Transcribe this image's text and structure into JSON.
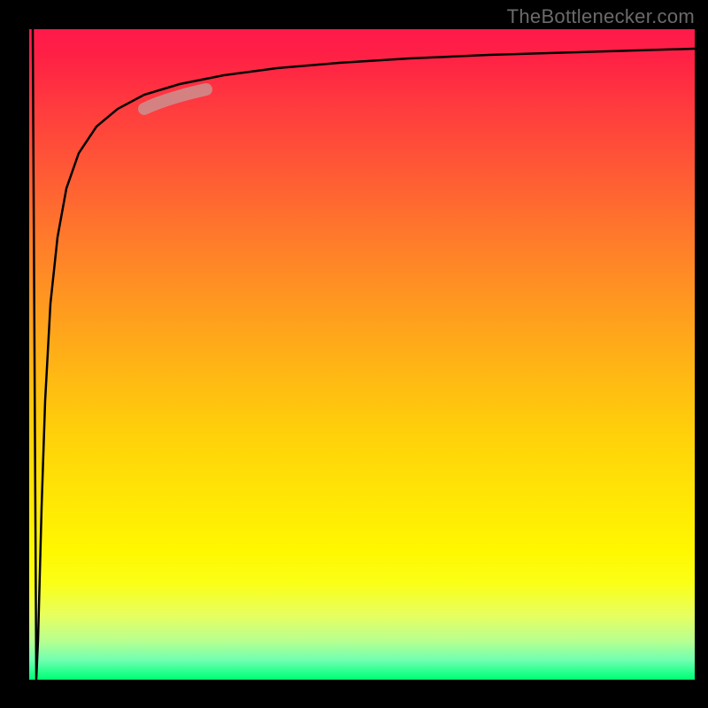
{
  "attribution_text": "TheBottlenecker.com",
  "chart_data": {
    "type": "line",
    "title": "",
    "xlabel": "",
    "ylabel": "",
    "xlim": [
      0,
      100
    ],
    "ylim": [
      0,
      100
    ],
    "series": [
      {
        "name": "curve",
        "type": "line",
        "points": [
          {
            "x": 0.5,
            "y": 100
          },
          {
            "x": 1.0,
            "y": 0
          },
          {
            "x": 1.5,
            "y": 30
          },
          {
            "x": 2.0,
            "y": 48
          },
          {
            "x": 3.0,
            "y": 65
          },
          {
            "x": 5.0,
            "y": 77
          },
          {
            "x": 8.0,
            "y": 84
          },
          {
            "x": 12.0,
            "y": 88
          },
          {
            "x": 18.0,
            "y": 91
          },
          {
            "x": 25.0,
            "y": 93
          },
          {
            "x": 35.0,
            "y": 94.5
          },
          {
            "x": 50.0,
            "y": 95.5
          },
          {
            "x": 70.0,
            "y": 96.3
          },
          {
            "x": 100.0,
            "y": 97
          }
        ]
      },
      {
        "name": "highlight_segment",
        "type": "line_segment",
        "color": "#d67676",
        "points": [
          {
            "x": 16,
            "y": 88
          },
          {
            "x": 27,
            "y": 91
          }
        ]
      }
    ],
    "gradient_background": {
      "direction": "vertical",
      "stops": [
        {
          "pos": 0,
          "color": "#ff1a4a"
        },
        {
          "pos": 50,
          "color": "#ffd00a"
        },
        {
          "pos": 85,
          "color": "#fbff15"
        },
        {
          "pos": 100,
          "color": "#00ff70"
        }
      ]
    }
  }
}
